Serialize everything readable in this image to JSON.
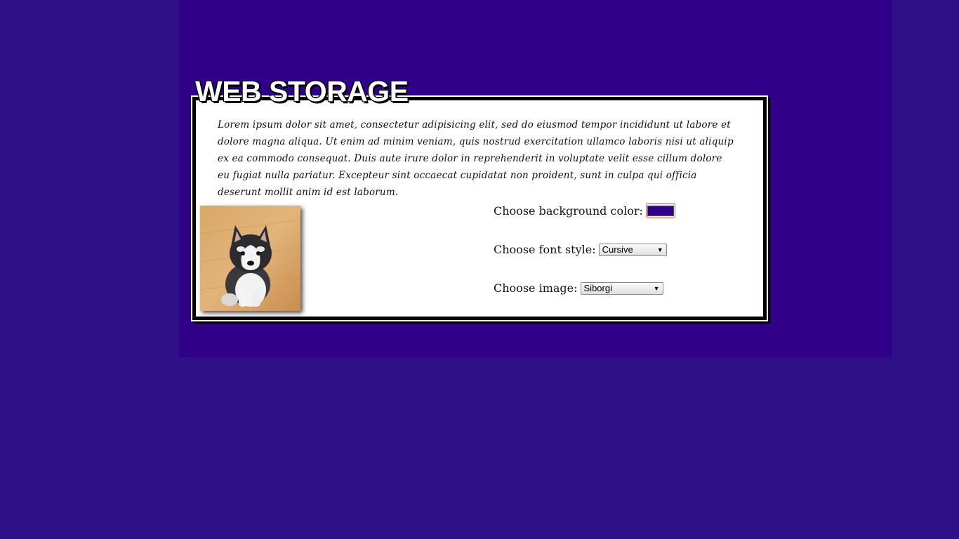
{
  "page": {
    "title": "WEB STORAGE",
    "background_color": "#2e1189",
    "wrapper_color": "#310088"
  },
  "content": {
    "lorem": "Lorem ipsum dolor sit amet, consectetur adipisicing elit, sed do eiusmod tempor incididunt ut labore et dolore magna aliqua. Ut enim ad minim veniam, quis nostrud exercitation ullamco laboris nisi ut aliquip ex ea commodo consequat. Duis aute irure dolor in reprehenderit in voluptate velit esse cillum dolore eu fugiat nulla pariatur. Excepteur sint occaecat cupidatat non proident, sunt in culpa qui officia deserunt mollit anim id est laborum.",
    "image_subject": "puppy-photo"
  },
  "controls": {
    "bg_color_label": "Choose background color:",
    "bg_color_value": "#310088",
    "font_style_label": "Choose font style:",
    "font_style_value": "Cursive",
    "image_label": "Choose image:",
    "image_value": "Siborgi"
  }
}
